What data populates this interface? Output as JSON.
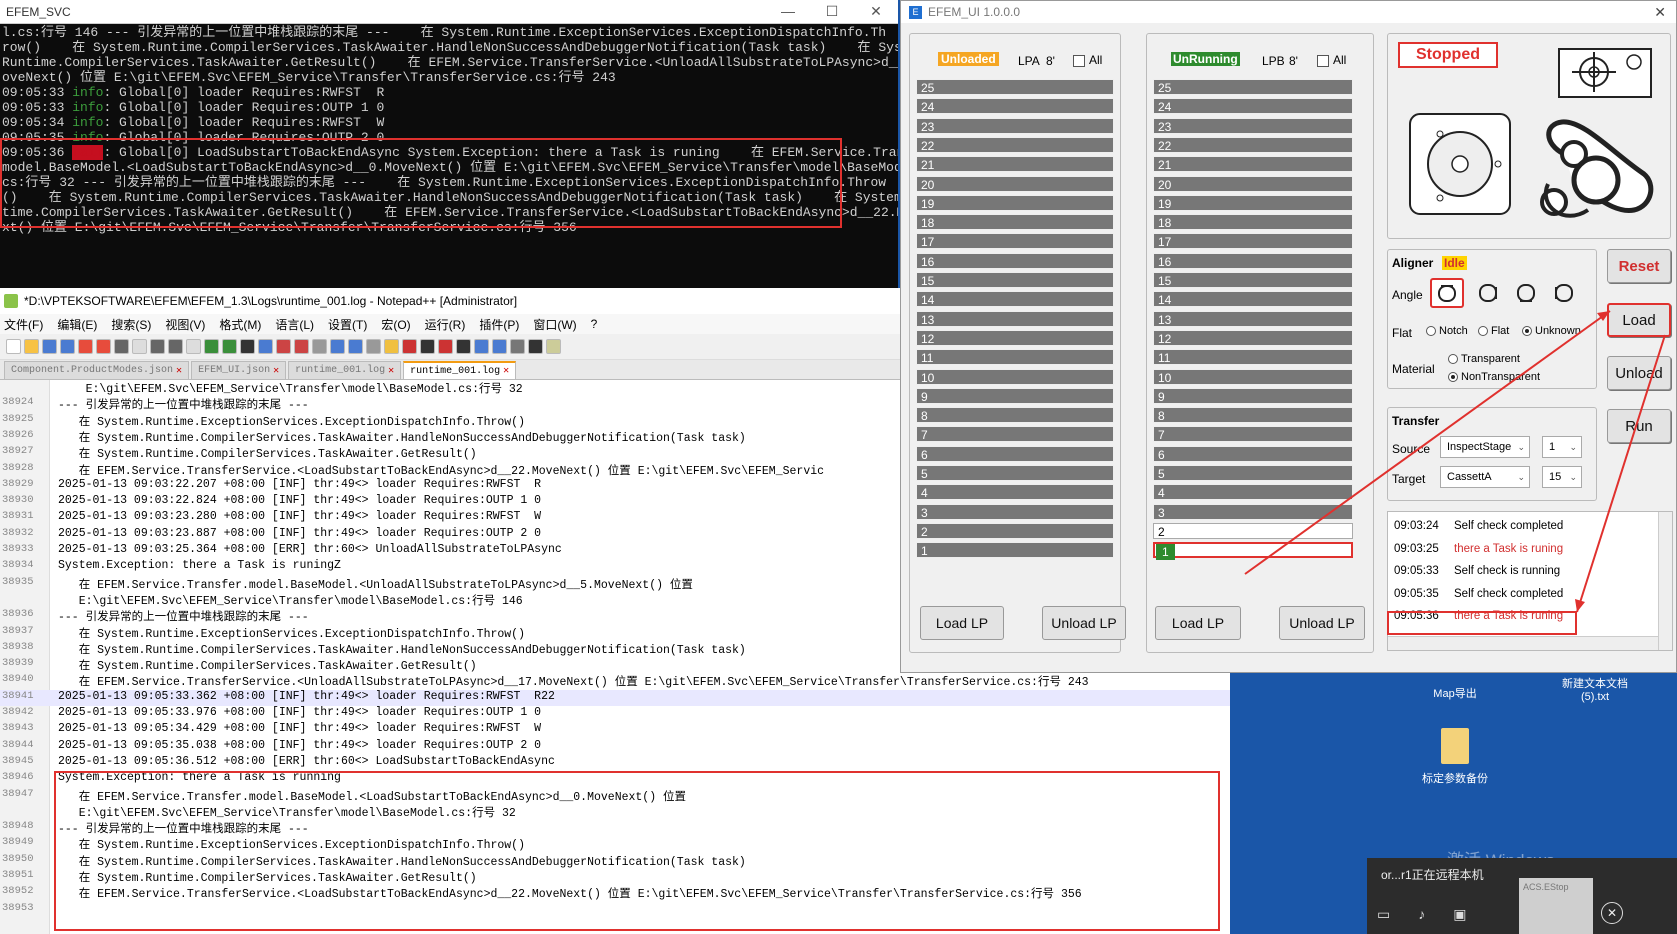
{
  "console": {
    "title": "EFEM_SVC",
    "lines_before": [
      "l.cs:行号 146 --- 引发异常的上一位置中堆栈跟踪的末尾 ---    在 System.Runtime.ExceptionServices.ExceptionDispatchInfo.Th",
      "row()    在 System.Runtime.CompilerServices.TaskAwaiter.HandleNonSuccessAndDebuggerNotification(Task task)    在 System.",
      "Runtime.CompilerServices.TaskAwaiter.GetResult()    在 EFEM.Service.TransferService.<UnloadAllSubstrateToLPAsync>d__17.M",
      "oveNext() 位置 E:\\git\\EFEM.Svc\\EFEM_Service\\Transfer\\TransferService.cs:行号 243"
    ],
    "info_lines": [
      {
        "time": "09:05:33",
        "level": "info",
        "msg": ": Global[0] loader Requires:RWFST  R"
      },
      {
        "time": "09:05:33",
        "level": "info",
        "msg": ": Global[0] loader Requires:OUTP 1 0"
      },
      {
        "time": "09:05:34",
        "level": "info",
        "msg": ": Global[0] loader Requires:RWFST  W"
      },
      {
        "time": "09:05:35",
        "level": "info",
        "msg": ": Global[0] loader Requires:OUTP 2 0"
      }
    ],
    "fail_time": "09:05:36",
    "fail_level": "fail",
    "fail_lines": [
      ": Global[0] LoadSubstartToBackEndAsync System.Exception: there a Task is runing    在 EFEM.Service.Transfer",
      "model.BaseModel.<LoadSubstartToBackEndAsync>d__0.MoveNext() 位置 E:\\git\\EFEM.Svc\\EFEM_Service\\Transfer\\model\\BaseModel.",
      "cs:行号 32 --- 引发异常的上一位置中堆栈跟踪的末尾 ---    在 System.Runtime.ExceptionServices.ExceptionDispatchInfo.Throw",
      "()    在 System.Runtime.CompilerServices.TaskAwaiter.HandleNonSuccessAndDebuggerNotification(Task task)    在 System.Run",
      "time.CompilerServices.TaskAwaiter.GetResult()    在 EFEM.Service.TransferService.<LoadSubstartToBackEndAsync>d__22.MoveNe",
      "xt() 位置 E:\\git\\EFEM.Svc\\EFEM_Service\\Transfer\\TransferService.cs:行号 356"
    ]
  },
  "notepad": {
    "title": "*D:\\VPTEKSOFTWARE\\EFEM\\EFEM_1.3\\Logs\\runtime_001.log - Notepad++ [Administrator]",
    "menu": [
      "文件(F)",
      "编辑(E)",
      "搜索(S)",
      "视图(V)",
      "格式(M)",
      "语言(L)",
      "设置(T)",
      "宏(O)",
      "运行(R)",
      "插件(P)",
      "窗口(W)",
      "?"
    ],
    "tabs": [
      "Component.ProductModes.json",
      "EFEM_UI.json",
      "runtime_001.log",
      "runtime_001.log"
    ],
    "lines": [
      {
        "n": "",
        "t": "    E:\\git\\EFEM.Svc\\EFEM_Service\\Transfer\\model\\BaseModel.cs:行号 32"
      },
      {
        "n": "38924",
        "t": "--- 引发异常的上一位置中堆栈跟踪的末尾 ---"
      },
      {
        "n": "38925",
        "t": "   在 System.Runtime.ExceptionServices.ExceptionDispatchInfo.Throw()"
      },
      {
        "n": "38926",
        "t": "   在 System.Runtime.CompilerServices.TaskAwaiter.HandleNonSuccessAndDebuggerNotification(Task task)"
      },
      {
        "n": "38927",
        "t": "   在 System.Runtime.CompilerServices.TaskAwaiter.GetResult()"
      },
      {
        "n": "38928",
        "t": "   在 EFEM.Service.TransferService.<LoadSubstartToBackEndAsync>d__22.MoveNext() 位置 E:\\git\\EFEM.Svc\\EFEM_Servic"
      },
      {
        "n": "38929",
        "t": "2025-01-13 09:03:22.207 +08:00 [INF] thr:49<> loader Requires:RWFST  R"
      },
      {
        "n": "38930",
        "t": "2025-01-13 09:03:22.824 +08:00 [INF] thr:49<> loader Requires:OUTP 1 0"
      },
      {
        "n": "38931",
        "t": "2025-01-13 09:03:23.280 +08:00 [INF] thr:49<> loader Requires:RWFST  W"
      },
      {
        "n": "38932",
        "t": "2025-01-13 09:03:23.887 +08:00 [INF] thr:49<> loader Requires:OUTP 2 0"
      },
      {
        "n": "38933",
        "t": "2025-01-13 09:03:25.364 +08:00 [ERR] thr:60<> UnloadAllSubstrateToLPAsync"
      },
      {
        "n": "38934",
        "t": "System.Exception: there a Task is runingZ"
      },
      {
        "n": "38935",
        "t": "   在 EFEM.Service.Transfer.model.BaseModel.<UnloadAllSubstrateToLPAsync>d__5.MoveNext() 位置"
      },
      {
        "n": "",
        "t": "   E:\\git\\EFEM.Svc\\EFEM_Service\\Transfer\\model\\BaseModel.cs:行号 146"
      },
      {
        "n": "38936",
        "t": "--- 引发异常的上一位置中堆栈跟踪的末尾 ---"
      },
      {
        "n": "38937",
        "t": "   在 System.Runtime.ExceptionServices.ExceptionDispatchInfo.Throw()"
      },
      {
        "n": "38938",
        "t": "   在 System.Runtime.CompilerServices.TaskAwaiter.HandleNonSuccessAndDebuggerNotification(Task task)"
      },
      {
        "n": "38939",
        "t": "   在 System.Runtime.CompilerServices.TaskAwaiter.GetResult()"
      },
      {
        "n": "38940",
        "t": "   在 EFEM.Service.TransferService.<UnloadAllSubstrateToLPAsync>d__17.MoveNext() 位置 E:\\git\\EFEM.Svc\\EFEM_Service\\Transfer\\TransferService.cs:行号 243"
      },
      {
        "n": "38941",
        "t": "2025-01-13 09:05:33.362 +08:00 [INF] thr:49<> loader Requires:RWFST  R22"
      },
      {
        "n": "38942",
        "t": "2025-01-13 09:05:33.976 +08:00 [INF] thr:49<> loader Requires:OUTP 1 0"
      },
      {
        "n": "38943",
        "t": "2025-01-13 09:05:34.429 +08:00 [INF] thr:49<> loader Requires:RWFST  W"
      },
      {
        "n": "38944",
        "t": "2025-01-13 09:05:35.038 +08:00 [INF] thr:49<> loader Requires:OUTP 2 0"
      },
      {
        "n": "38945",
        "t": "2025-01-13 09:05:36.512 +08:00 [ERR] thr:60<> LoadSubstartToBackEndAsync"
      },
      {
        "n": "38946",
        "t": "System.Exception: there a Task is running"
      },
      {
        "n": "38947",
        "t": "   在 EFEM.Service.Transfer.model.BaseModel.<LoadSubstartToBackEndAsync>d__0.MoveNext() 位置"
      },
      {
        "n": "",
        "t": "   E:\\git\\EFEM.Svc\\EFEM_Service\\Transfer\\model\\BaseModel.cs:行号 32"
      },
      {
        "n": "38948",
        "t": "--- 引发异常的上一位置中堆栈跟踪的末尾 ---"
      },
      {
        "n": "38949",
        "t": "   在 System.Runtime.ExceptionServices.ExceptionDispatchInfo.Throw()"
      },
      {
        "n": "38950",
        "t": "   在 System.Runtime.CompilerServices.TaskAwaiter.HandleNonSuccessAndDebuggerNotification(Task task)"
      },
      {
        "n": "38951",
        "t": "   在 System.Runtime.CompilerServices.TaskAwaiter.GetResult()"
      },
      {
        "n": "38952",
        "t": "   在 EFEM.Service.TransferService.<LoadSubstartToBackEndAsync>d__22.MoveNext() 位置 E:\\git\\EFEM.Svc\\EFEM_Service\\Transfer\\TransferService.cs:行号 356"
      },
      {
        "n": "38953",
        "t": ""
      }
    ]
  },
  "efem": {
    "title": "EFEM_UI 1.0.0.0",
    "lpa": {
      "status": "Unloaded",
      "status_color": "#f5a623",
      "name": "LPA",
      "size": "8'",
      "all": "All",
      "load": "Load LP",
      "unload": "Unload LP"
    },
    "lpb": {
      "status": "UnRunning",
      "status_color": "#2e8b2e",
      "name": "LPB",
      "size": "8'",
      "all": "All",
      "load": "Load LP",
      "unload": "Unload LP"
    },
    "slots": [
      "25",
      "24",
      "23",
      "22",
      "21",
      "20",
      "19",
      "18",
      "17",
      "16",
      "15",
      "14",
      "13",
      "12",
      "11",
      "10",
      "9",
      "8",
      "7",
      "6",
      "5",
      "4",
      "3",
      "2",
      "1"
    ],
    "lpb_slot2_label": "2",
    "lpb_slot1_label": "1",
    "state": "Stopped",
    "aligner": {
      "label": "Aligner",
      "status": "Idle",
      "angle": "Angle",
      "flat": "Flat",
      "opt_notch": "Notch",
      "opt_flat": "Flat",
      "opt_unknown": "Unknown",
      "material": "Material",
      "opt_transparent": "Transparent",
      "opt_nontransparent": "NonTransparent"
    },
    "buttons": {
      "reset": "Reset",
      "load": "Load",
      "unload": "Unload",
      "run": "Run"
    },
    "transfer": {
      "label": "Transfer",
      "source": "Source",
      "target": "Target",
      "source_val": "InspectStage",
      "source_slot": "1",
      "target_val": "CassettA",
      "target_slot": "15"
    },
    "log": [
      {
        "time": "09:03:24",
        "msg": "Self check completed",
        "err": false
      },
      {
        "time": "09:03:25",
        "msg": "there a Task is runing",
        "err": true
      },
      {
        "time": "09:05:33",
        "msg": "Self check is running",
        "err": false
      },
      {
        "time": "09:05:35",
        "msg": "Self check completed",
        "err": false
      },
      {
        "time": "09:05:36",
        "msg": "there a Task is runing",
        "err": true
      }
    ]
  },
  "desktop": {
    "icon1": "Map导出",
    "icon2a": "新建文本文档",
    "icon2b": "(5).txt",
    "icon3": "标定参数备份",
    "watermark": "激活 Windows",
    "notif": "or...r1正在远程本机",
    "notif2": "ACS.EStop"
  }
}
